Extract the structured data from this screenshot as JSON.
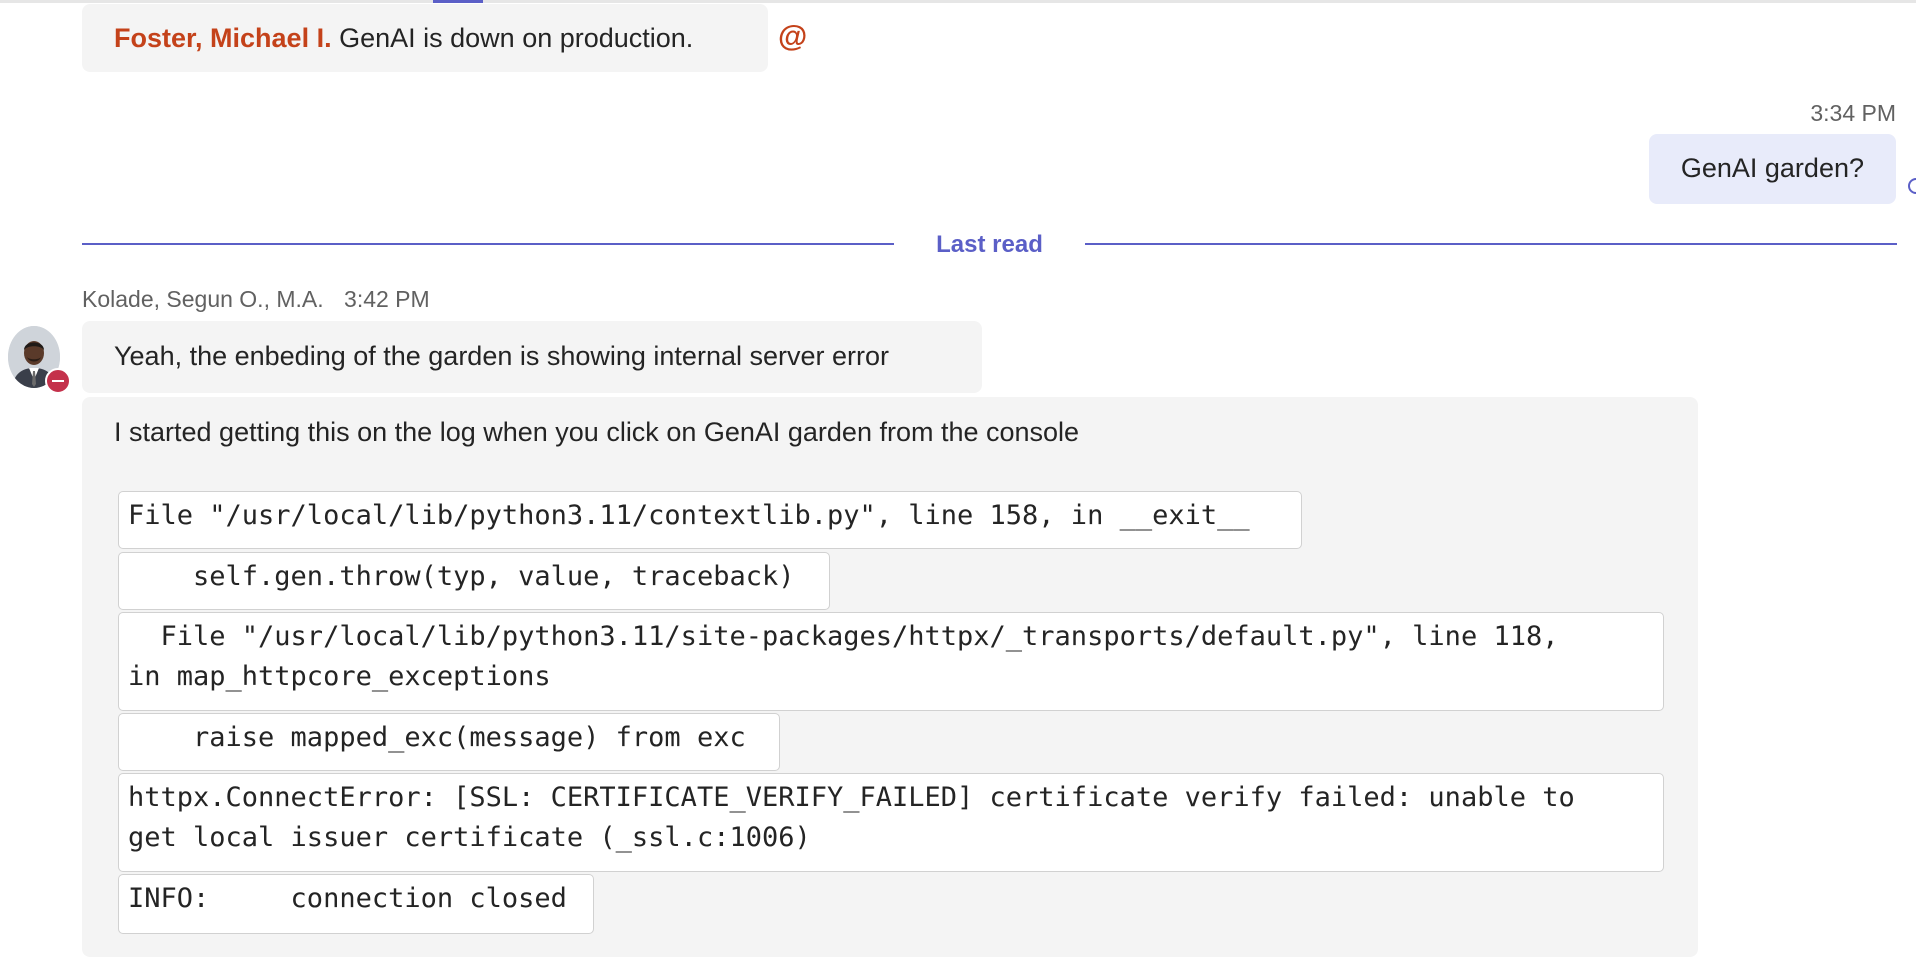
{
  "colors": {
    "accent": "#5b5fc7",
    "mention": "#c4421a",
    "presence_busy": "#c4314b",
    "bubble_own": "#e8ebfa",
    "bubble_other": "#f4f4f4"
  },
  "message1": {
    "mention": "Foster, Michael I.",
    "text": "GenAI is down on production.",
    "at_icon": "@"
  },
  "own_message": {
    "time": "3:34 PM",
    "text": "GenAI garden?"
  },
  "divider": {
    "label": "Last read"
  },
  "incoming": {
    "author": "Kolade, Segun O., M.A.",
    "time": "3:42 PM",
    "text1": "Yeah, the enbeding of the garden is showing internal server error",
    "text2": "I started getting this on the log when you click on GenAI garden from the console",
    "code_lines": [
      "File \"/usr/local/lib/python3.11/contextlib.py\", line 158, in __exit__",
      "    self.gen.throw(typ, value, traceback)",
      "  File \"/usr/local/lib/python3.11/site-packages/httpx/_transports/default.py\", line 118,\nin map_httpcore_exceptions",
      "    raise mapped_exc(message) from exc",
      "httpx.ConnectError: [SSL: CERTIFICATE_VERIFY_FAILED] certificate verify failed: unable to\nget local issuer certificate (_ssl.c:1006)",
      "INFO:     connection closed"
    ]
  }
}
